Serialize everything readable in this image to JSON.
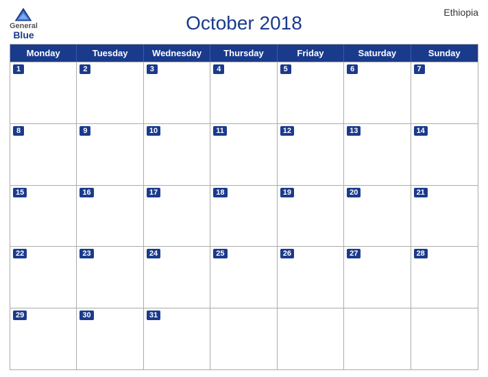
{
  "header": {
    "title": "October 2018",
    "country": "Ethiopia",
    "logo": {
      "general": "General",
      "blue": "Blue"
    }
  },
  "days": {
    "headers": [
      "Monday",
      "Tuesday",
      "Wednesday",
      "Thursday",
      "Friday",
      "Saturday",
      "Sunday"
    ]
  },
  "weeks": [
    [
      {
        "num": "1",
        "blue": false
      },
      {
        "num": "2",
        "blue": false
      },
      {
        "num": "3",
        "blue": false
      },
      {
        "num": "4",
        "blue": false
      },
      {
        "num": "5",
        "blue": false
      },
      {
        "num": "6",
        "blue": false
      },
      {
        "num": "7",
        "blue": false
      }
    ],
    [
      {
        "num": "8",
        "blue": false
      },
      {
        "num": "9",
        "blue": false
      },
      {
        "num": "10",
        "blue": false
      },
      {
        "num": "11",
        "blue": false
      },
      {
        "num": "12",
        "blue": false
      },
      {
        "num": "13",
        "blue": false
      },
      {
        "num": "14",
        "blue": false
      }
    ],
    [
      {
        "num": "15",
        "blue": false
      },
      {
        "num": "16",
        "blue": false
      },
      {
        "num": "17",
        "blue": false
      },
      {
        "num": "18",
        "blue": false
      },
      {
        "num": "19",
        "blue": false
      },
      {
        "num": "20",
        "blue": false
      },
      {
        "num": "21",
        "blue": false
      }
    ],
    [
      {
        "num": "22",
        "blue": false
      },
      {
        "num": "23",
        "blue": false
      },
      {
        "num": "24",
        "blue": false
      },
      {
        "num": "25",
        "blue": false
      },
      {
        "num": "26",
        "blue": false
      },
      {
        "num": "27",
        "blue": false
      },
      {
        "num": "28",
        "blue": false
      }
    ],
    [
      {
        "num": "29",
        "blue": false
      },
      {
        "num": "30",
        "blue": false
      },
      {
        "num": "31",
        "blue": false
      },
      {
        "num": "",
        "blue": false
      },
      {
        "num": "",
        "blue": false
      },
      {
        "num": "",
        "blue": false
      },
      {
        "num": "",
        "blue": false
      }
    ]
  ]
}
